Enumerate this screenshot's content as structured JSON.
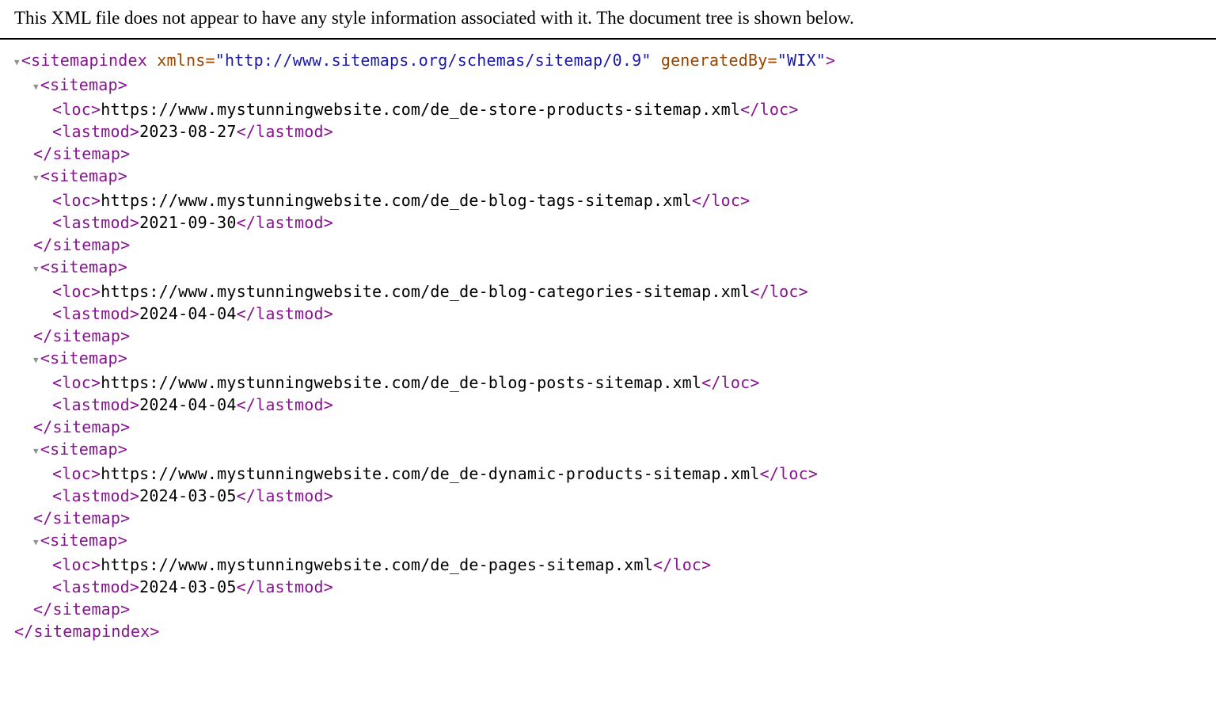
{
  "notice": "This XML file does not appear to have any style information associated with it. The document tree is shown below.",
  "root": {
    "tag": "sitemapindex",
    "attrs": [
      {
        "name": "xmlns",
        "value": "http://www.sitemaps.org/schemas/sitemap/0.9"
      },
      {
        "name": "generatedBy",
        "value": "WIX"
      }
    ]
  },
  "sitemaps": [
    {
      "loc": "https://www.mystunningwebsite.com/de_de-store-products-sitemap.xml",
      "lastmod": "2023-08-27"
    },
    {
      "loc": "https://www.mystunningwebsite.com/de_de-blog-tags-sitemap.xml",
      "lastmod": "2021-09-30"
    },
    {
      "loc": "https://www.mystunningwebsite.com/de_de-blog-categories-sitemap.xml",
      "lastmod": "2024-04-04"
    },
    {
      "loc": "https://www.mystunningwebsite.com/de_de-blog-posts-sitemap.xml",
      "lastmod": "2024-04-04"
    },
    {
      "loc": "https://www.mystunningwebsite.com/de_de-dynamic-products-sitemap.xml",
      "lastmod": "2024-03-05"
    },
    {
      "loc": "https://www.mystunningwebsite.com/de_de-pages-sitemap.xml",
      "lastmod": "2024-03-05"
    }
  ]
}
